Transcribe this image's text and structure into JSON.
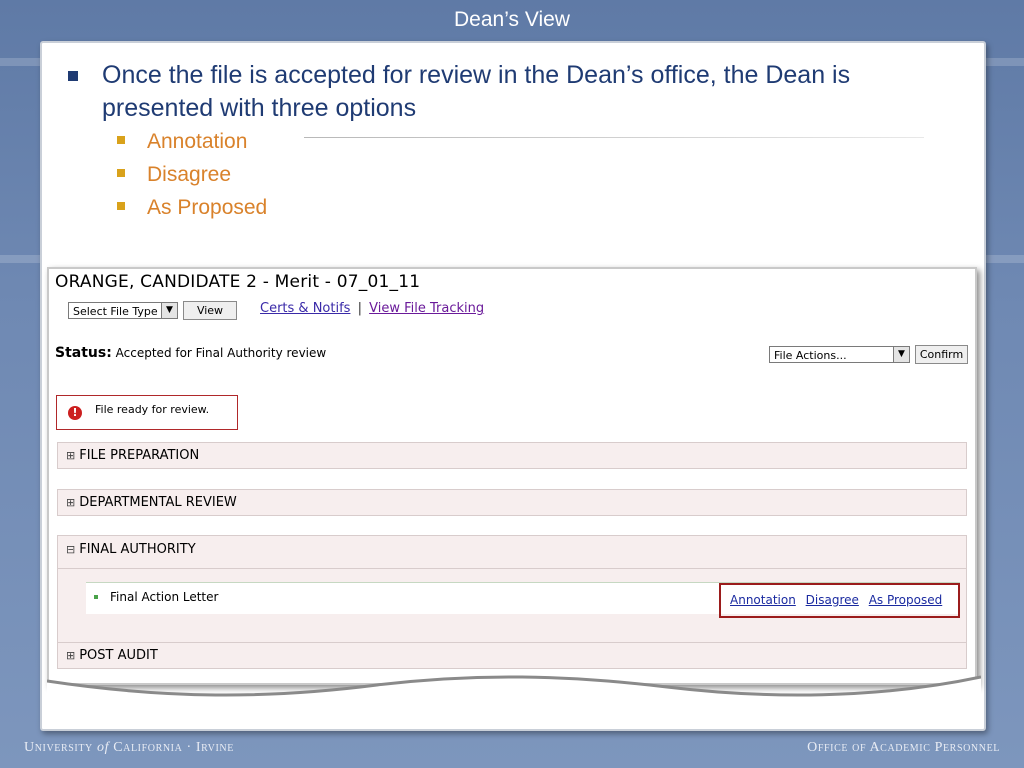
{
  "slide": {
    "title": "Dean’s View",
    "bullet_main": "Once the file is accepted for review in the Dean’s office, the Dean is presented with three options",
    "sub_bullets": [
      "Annotation",
      "Disagree",
      "As Proposed"
    ]
  },
  "screen": {
    "candidate_title": "ORANGE, CANDIDATE 2 - Merit - 07_01_11",
    "file_type_select": "Select File Type",
    "view_button": "View",
    "certs_link": "Certs & Notifs",
    "separator": "|",
    "tracking_link": "View File Tracking",
    "status_label": "Status:",
    "status_value": "Accepted for Final Authority review",
    "file_actions_select": "File Actions...",
    "confirm_button": "Confirm",
    "alert_text": "File ready for review.",
    "alert_icon": "!",
    "sections": [
      {
        "toggle": "⊞",
        "label": "FILE PREPARATION"
      },
      {
        "toggle": "⊞",
        "label": "DEPARTMENTAL REVIEW"
      },
      {
        "toggle": "⊟",
        "label": "FINAL AUTHORITY"
      },
      {
        "toggle": "⊞",
        "label": "POST AUDIT"
      }
    ],
    "final_authority_item": "Final Action Letter",
    "actions": [
      "Annotation",
      "Disagree",
      "As Proposed"
    ]
  },
  "footer": {
    "left_a": "University",
    "left_of": "of",
    "left_b": "California · Irvine",
    "right": "Office of Academic Personnel"
  },
  "colors": {
    "background": "#6f89b3",
    "bullet_text": "#1f3b73",
    "sub_bullet_text": "#d9822b",
    "highlight_border": "#9b1c1c"
  }
}
